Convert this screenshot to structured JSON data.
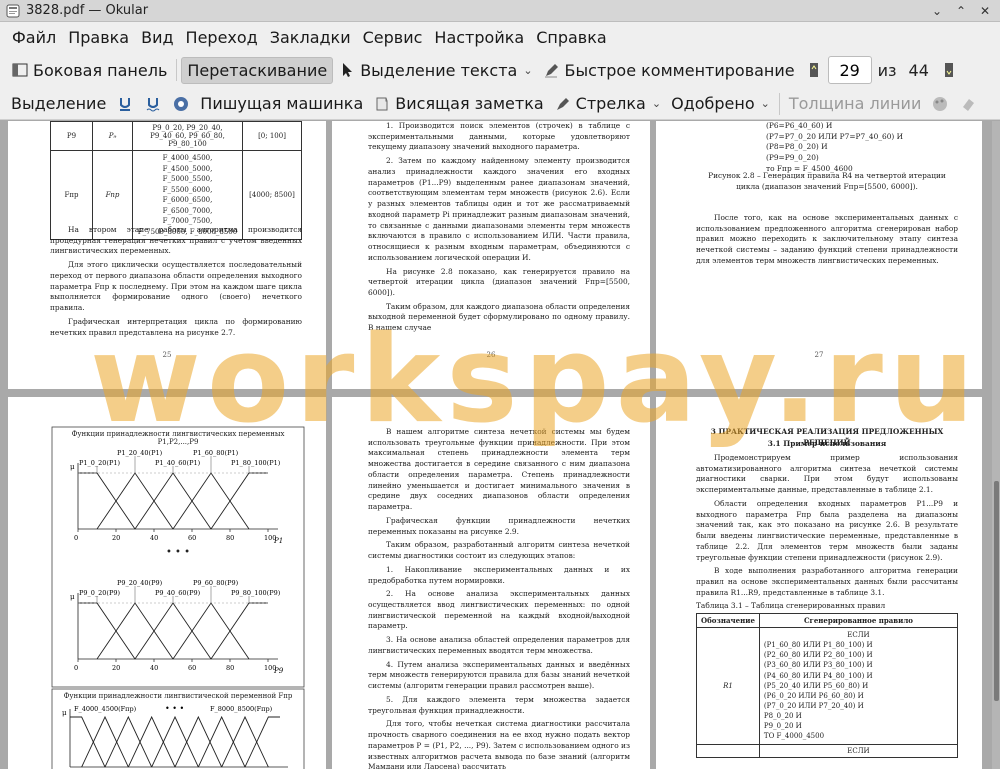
{
  "window": {
    "title": "3828.pdf  — Okular"
  },
  "menu": [
    "Файл",
    "Правка",
    "Вид",
    "Переход",
    "Закладки",
    "Сервис",
    "Настройка",
    "Справка"
  ],
  "toolbar1": {
    "sidebar": "Боковая панель",
    "drag": "Перетаскивание",
    "text_select": "Выделение текста",
    "quick_comment": "Быстрое комментирование",
    "page_current": "29",
    "page_of": "из",
    "page_total": "44"
  },
  "toolbar2": {
    "selection": "Выделение",
    "typewriter": "Пишущая машинка",
    "hanging_note": "Висящая заметка",
    "arrow": "Стрелка",
    "approved": "Одобрено",
    "line_width": "Толщина линии"
  },
  "watermark": "workspay.ru",
  "pages": {
    "p25": {
      "number": "25",
      "table": [
        [
          "P9",
          "P₉",
          "P9_0_20, P9_20_40, P9_40_60, P9_60_80, P9_80_100",
          "[0; 100]"
        ],
        [
          "Fпр",
          "Fпр",
          "F_4000_4500, F_4500_5000, F_5000_5500, F_5500_6000, F_6000_6500, F_6500_7000, F_7000_7500, F_7500_8000, F_8000_8500",
          "[4000; 8500]"
        ]
      ],
      "paragraphs": [
        "На втором этапе работы алгоритма производится процедурная генерация нечетких правил с учетом введенных лингвистических переменных.",
        "Для этого циклически осуществляется последовательный переход от первого диапазона области определения выходного параметра Fпр к последнему. При этом на каждом шаге цикла выполняется формирование одного (своего) нечеткого правила.",
        "Графическая интерпретация цикла по формированию нечетких правил представлена на рисунке 2.7."
      ]
    },
    "p26": {
      "number": "26",
      "paragraphs": [
        "1. Производится поиск элементов (строчек) в таблице с экспериментальными данными, которые удовлетворяют текущему диапазону значений выходного параметра.",
        "2. Затем по каждому найденному элементу производится анализ принадлежности каждого значения его входных параметров (P1...P9) выделенным ранее диапазонам значений, соответствующим элементам терм множеств (рисунок 2.6). Если у разных элементов таблицы один и тот же рассматриваемый входной параметр Pi принадлежит разным диапазонам значений, то связанные с данными диапазонами элементы терм множеств включаются в правило с использованием ИЛИ. Части правила, относящиеся к разным входным параметрам, объединяются с использованием логической операции И.",
        "На рисунке 2.8 показано, как генерируется правило на четвертой итерации цикла (диапазон значений Fпр=[5500, 6000]).",
        "Таким образом, для каждого диапазона области определения выходной переменной будет сформулировано по одному правилу. В нашем случае"
      ]
    },
    "p27": {
      "number": "27",
      "rule_lines": [
        "(P6=P6_40_60) И",
        "(P7=P7_0_20 ИЛИ P7=P7_40_60) И",
        "(P8=P8_0_20) И",
        "(P9=P9_0_20)",
        "то Fпр = F_4500_4600"
      ],
      "caption": "Рисунок 2.8 – Генерация правила R4 на четвертой итерации цикла (диапазон значений Fпр=[5500, 6000]).",
      "paragraph": "После того, как на основе экспериментальных данных с использованием предложенного алгоритма сгенерирован набор правил можно переходить к заключительному этапу синтеза нечеткой системы – заданию функций степени принадлежности для элементов терм множеств лингвистических переменных."
    },
    "p28": {
      "chart1_title": "Функции принадлежности лингвистических переменных P1,P2,...,P9",
      "chart1_labels": [
        "P1_20_40(P1)",
        "P1_60_80(P1)",
        "P1_0_20(P1)",
        "P1_40_60(P1)",
        "P1_80_100(P1)"
      ],
      "chart2_labels": [
        "P9_20_40(P9)",
        "P9_60_80(P9)",
        "P9_0_20(P9)",
        "P9_40_60(P9)",
        "P9_80_100(P9)"
      ],
      "ticks": [
        "0",
        "20",
        "40",
        "60",
        "80",
        "100"
      ],
      "axis_mu": "μ",
      "axis_p1": "P1",
      "axis_p9": "P9",
      "ellipsis": "• • •",
      "chart3_title": "Функции принадлежности лингвистической переменной Fпр",
      "chart3_labels": [
        "F_4000_4500(Fпр)",
        "F_8000_8500(Fпр)"
      ]
    },
    "p29": {
      "paragraphs": [
        "В нашем алгоритме синтеза нечеткой системы мы будем использовать треугольные функции принадлежности. При этом максимальная степень принадлежности элемента терм множества достигается в середине связанного с ним диапазона области определения параметра. Степень принадлежности линейно уменьшается и достигает минимального значения в средине двух соседних диапазонов области определения параметра.",
        "Графическая функции принадлежности нечетких переменных показаны на рисунке 2.9.",
        "Таким образом, разработанный алгоритм синтеза нечеткой системы диагностики состоит из следующих этапов:",
        "1. Накопливание экспериментальных данных и их предобработка путем нормировки.",
        "2. На основе анализа экспериментальных данных осуществляется ввод лингвистических переменных: по одной лингвистической переменной на каждый входной/выходной параметр.",
        "3. На основе анализа областей определения параметров для лингвистических переменных вводятся терм множества.",
        "4. Путем анализа экспериментальных данных и введённых терм множеств генерируются правила для базы знаний нечеткой системы (алгоритм генерации правил рассмотрен выше).",
        "5. Для каждого элемента терм множества задается треугольная функция принадлежности.",
        "Для того, чтобы нечеткая система диагностики рассчитала прочность сварного соединения на ее вход нужно подать вектор параметров P = (P1, P2, ..., P9). Затем с использованием одного из известных алгоритмов расчета вывода по базе знаний (алгоритм Мамдани или Ларсена) рассчитать"
      ]
    },
    "p30": {
      "heading": "3 ПРАКТИЧЕСКАЯ РЕАЛИЗАЦИЯ ПРЕДЛОЖЕННЫХ РЕШЕНИЙ",
      "subheading": "3.1 Пример использования",
      "paragraphs": [
        "Продемонстрируем пример использования автоматизированного алгоритма синтеза нечеткой системы диагностики сварки. При этом будут использованы экспериментальные данные, представленные в таблице 2.1.",
        "Области определения входных параметров P1...P9 и выходного параметра Fпр была разделена на диапазоны значений так, как это показано на рисунке 2.6. В результате были введены лингвистические переменные, представленные в таблице 2.2. Для элементов терм множеств были заданы треугольные функции степени принадлежности (рисунок 2.9).",
        "В ходе выполнения разработанного алгоритма генерации правил на основе экспериментальных данных были рассчитаны правила R1...R9, представленные в таблице 3.1."
      ],
      "table_caption": "Таблица 3.1 – Таблица сгенерированных правил",
      "table_headers": [
        "Обозначение",
        "Сгенерированное правило"
      ],
      "rule_label": "R1",
      "rule_lines": [
        "ЕСЛИ",
        "(P1_60_80 ИЛИ P1_80_100) И",
        "(P2_60_80 ИЛИ P2_80_100) И",
        "(P3_60_80 ИЛИ P3_80_100) И",
        "(P4_60_80 ИЛИ P4_80_100) И",
        "(P5_20_40 ИЛИ P5_60_80) И",
        "(P6_0_20 ИЛИ P6_60_80) И",
        "(P7_0_20 ИЛИ P7_20_40) И",
        "P8_0_20 И",
        "P9_0_20 И",
        "ТО F_4000_4500"
      ],
      "next_rule": "ЕСЛИ"
    }
  }
}
